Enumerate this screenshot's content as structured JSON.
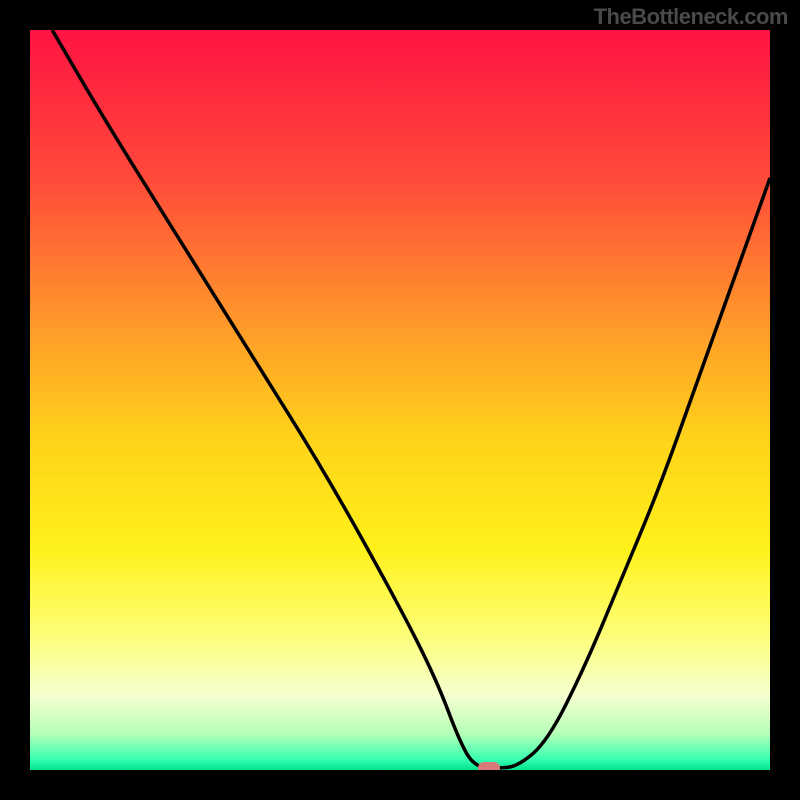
{
  "watermark": "TheBottleneck.com",
  "chart_data": {
    "type": "line",
    "title": "",
    "xlabel": "",
    "ylabel": "",
    "xlim": [
      0,
      100
    ],
    "ylim": [
      0,
      100
    ],
    "series": [
      {
        "name": "bottleneck-curve",
        "x": [
          3,
          10,
          20,
          30,
          40,
          50,
          55,
          58,
          60,
          63,
          66,
          70,
          75,
          80,
          85,
          90,
          95,
          100
        ],
        "y": [
          100,
          88,
          72,
          56,
          40,
          22,
          12,
          4,
          0.5,
          0.2,
          0.5,
          4,
          14,
          26,
          38,
          52,
          66,
          80
        ]
      }
    ],
    "marker": {
      "x": 62,
      "y": 0.3
    },
    "gradient_stops": [
      {
        "pos": 0.0,
        "color": "#ff1342"
      },
      {
        "pos": 0.2,
        "color": "#ff4a3a"
      },
      {
        "pos": 0.4,
        "color": "#ff9a2a"
      },
      {
        "pos": 0.55,
        "color": "#ffd21a"
      },
      {
        "pos": 0.7,
        "color": "#fff11a"
      },
      {
        "pos": 0.82,
        "color": "#fdff7a"
      },
      {
        "pos": 0.9,
        "color": "#f5ffd0"
      },
      {
        "pos": 0.95,
        "color": "#b8ffb8"
      },
      {
        "pos": 0.985,
        "color": "#3affb1"
      },
      {
        "pos": 1.0,
        "color": "#00e58f"
      }
    ]
  }
}
